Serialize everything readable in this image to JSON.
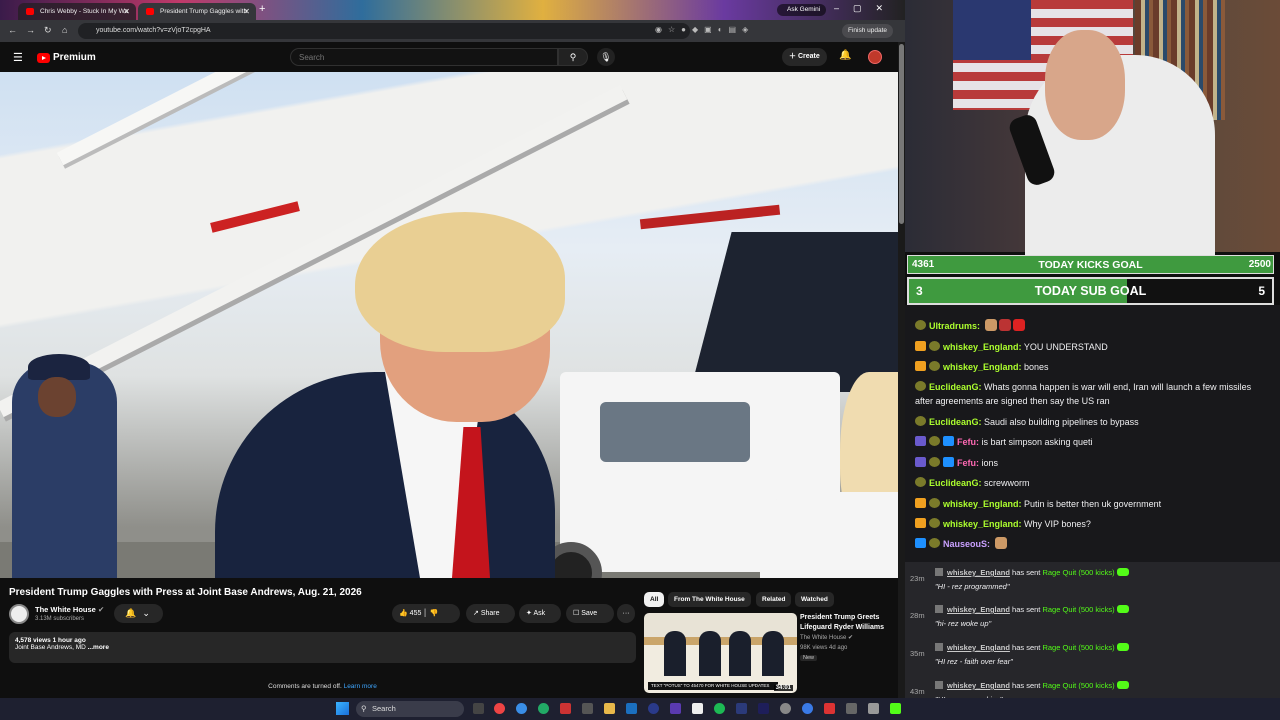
{
  "browser": {
    "tabs": [
      {
        "label": "Chris Webby - Stuck In My Wa"
      },
      {
        "label": "President Trump Gaggles with"
      }
    ],
    "new_tab": "+",
    "ask_gemini": "Ask Gemini",
    "url": "youtube.com/watch?v=zVjoT2cpgHA",
    "finish_update": "Finish update"
  },
  "youtube": {
    "logo": "Premium",
    "search_placeholder": "Search",
    "create_label": "Create",
    "video_title": "President Trump Gaggles with Press at Joint Base Andrews, Aug. 21, 2026",
    "channel": {
      "name": "The White House",
      "subscribers": "3.13M subscribers"
    },
    "actions": {
      "likes": "455",
      "share": "Share",
      "ask": "Ask",
      "save": "Save",
      "more": "···"
    },
    "description": {
      "views": "4,578 views  1 hour ago",
      "location": "Joint Base Andrews, MD",
      "more": "...more"
    },
    "comments": {
      "text": "Comments are turned off.",
      "link": "Learn more"
    },
    "chips": [
      "All",
      "From The White House",
      "Related",
      "Watched"
    ],
    "related": {
      "title": "President Trump Greets Lifeguard Ryder Williams",
      "channel": "The White House",
      "meta": "98K views  4d ago",
      "badge": "New",
      "duration": "34:01",
      "caption": "TEXT \"POTUS\" TO 45470 FOR WHITE HOUSE UPDATES"
    }
  },
  "stream": {
    "kicks_goal": {
      "current": "4361",
      "label": "TODAY KICKS GOAL",
      "target": "2500",
      "progress": 1.0
    },
    "sub_goal": {
      "current": "3",
      "label": "TODAY SUB GOAL",
      "target": "5",
      "progress": 0.6
    },
    "chat": [
      {
        "user": "Ultradrums:",
        "text": "",
        "color": "#adff2f",
        "badges": [
          "coin"
        ],
        "emotes": 3
      },
      {
        "user": "whiskey_England:",
        "text": "YOU UNDERSTAND",
        "color": "#adff2f",
        "badges": [
          "gold",
          "coin"
        ]
      },
      {
        "user": "whiskey_England:",
        "text": "bones",
        "color": "#adff2f",
        "badges": [
          "gold",
          "coin"
        ]
      },
      {
        "user": "EuclideanG:",
        "text": "Whats gonna happen is war will end, Iran will launch a few missiles after agreements are signed then say the US ran",
        "color": "#adff2f",
        "badges": [
          "coin"
        ]
      },
      {
        "user": "EuclideanG:",
        "text": "Saudi also building pipelines to bypass",
        "color": "#adff2f",
        "badges": [
          "coin"
        ]
      },
      {
        "user": "Fefu:",
        "text": "is bart simpson asking queti",
        "color": "#ff69b4",
        "badges": [
          "purp",
          "coin",
          "blue"
        ]
      },
      {
        "user": "Fefu:",
        "text": "ions",
        "color": "#ff69b4",
        "badges": [
          "purp",
          "coin",
          "blue"
        ]
      },
      {
        "user": "EuclideanG:",
        "text": "screwworm",
        "color": "#adff2f",
        "badges": [
          "coin"
        ]
      },
      {
        "user": "whiskey_England:",
        "text": "Putin is better then uk government",
        "color": "#adff2f",
        "badges": [
          "gold",
          "coin"
        ]
      },
      {
        "user": "whiskey_England:",
        "text": "Why VIP bones?",
        "color": "#adff2f",
        "badges": [
          "gold",
          "coin"
        ]
      },
      {
        "user": "NauseouS:",
        "text": "",
        "color": "#c9a0ff",
        "badges": [
          "blue",
          "coin"
        ],
        "emotes": 1
      }
    ],
    "feed": [
      {
        "time": "23m",
        "user": "whiskey_England",
        "action": "has sent",
        "item": "Rage Quit (500 kicks)",
        "quote": "\"HI - rez programmed\""
      },
      {
        "time": "28m",
        "user": "whiskey_England",
        "action": "has sent",
        "item": "Rage Quit (500 kicks)",
        "quote": "\"hi- rez woke up\""
      },
      {
        "time": "35m",
        "user": "whiskey_England",
        "action": "has sent",
        "item": "Rage Quit (500 kicks)",
        "quote": "\"HI rez - faith over fear\""
      },
      {
        "time": "43m",
        "user": "whiskey_England",
        "action": "has sent",
        "item": "Rage Quit (500 kicks)",
        "quote": "\"HI - rez - overdrive\""
      }
    ]
  },
  "taskbar": {
    "search": "Search"
  },
  "colors": {
    "youtube_red": "#ff0000",
    "kick_green": "#53fc18",
    "goal_green": "#3f9a3f"
  }
}
